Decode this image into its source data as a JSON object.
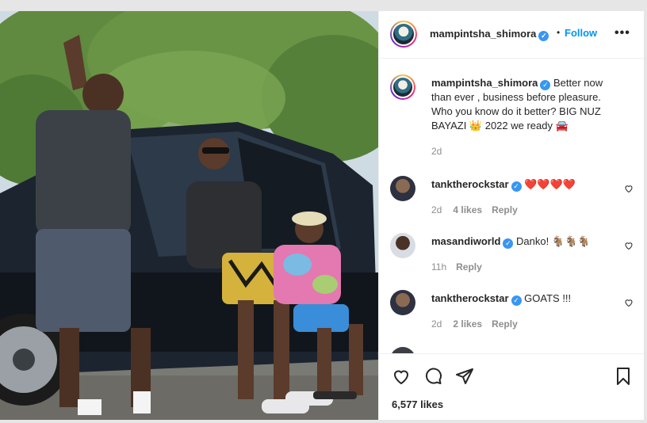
{
  "post": {
    "username": "mampintsha_shimora",
    "follow_label": "Follow",
    "separator": "•",
    "more_label": "•••",
    "caption_user": "mampintsha_shimora",
    "caption_text": "Better now than ever , business before pleasure. Who you know do it better? BIG NUZ BAYAZI 👑 2022 we ready 🚘",
    "caption_time": "2d",
    "likes": "6,577 likes"
  },
  "comments": [
    {
      "user": "tanktherockstar",
      "text": "❤️❤️❤️❤️",
      "time": "2d",
      "likes": "4 likes",
      "reply": "Reply"
    },
    {
      "user": "masandiworld",
      "text": "Danko! 🐐🐐🐐",
      "time": "11h",
      "likes": "",
      "reply": "Reply"
    },
    {
      "user": "tanktherockstar",
      "text": "GOATS !!!",
      "time": "2d",
      "likes": "2 likes",
      "reply": "Reply"
    }
  ],
  "icons": {
    "like": "heart-icon",
    "comment": "comment-icon",
    "share": "share-icon",
    "save": "bookmark-icon",
    "verified": "verified-badge-icon",
    "more": "more-options-icon"
  },
  "colors": {
    "follow": "#0095f6",
    "verified": "#3897f0",
    "heart": "#e0245e",
    "text": "#262626",
    "muted": "#8e8e8e"
  }
}
